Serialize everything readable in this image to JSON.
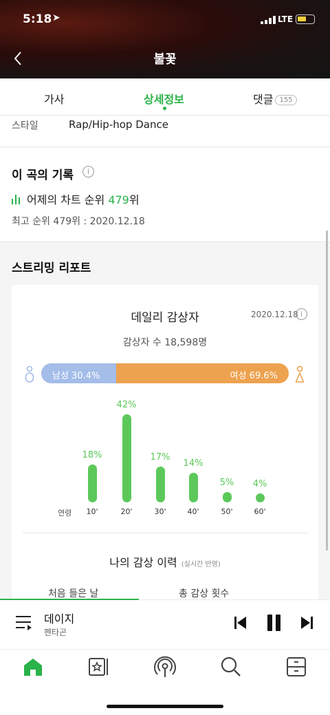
{
  "status": {
    "time": "5:18",
    "network": "LTE"
  },
  "header": {
    "title": "불꽃"
  },
  "tabs": [
    {
      "label": "가사"
    },
    {
      "label": "상세정보"
    },
    {
      "label": "댓글",
      "badge": "155"
    }
  ],
  "details": {
    "style_key": "스타일",
    "style_value": "Rap/Hip-hop Dance"
  },
  "record": {
    "title": "이 곡의 기록",
    "chart_prefix": "어제의 차트 순위 ",
    "chart_rank": "479",
    "chart_suffix": "위",
    "best": "최고 순위 479위 : 2020.12.18"
  },
  "streaming": {
    "title": "스트리밍 리포트",
    "daily_title": "데일리 감상자",
    "date": "2020.12.18",
    "listeners": "감상자 수 18,598명",
    "male_label": "남성 30.4%",
    "male_pct": 30.4,
    "female_label": "여성 69.6%",
    "age_axis_label": "연령",
    "ages": [
      {
        "label": "10'",
        "pct_text": "18%",
        "pct": 18
      },
      {
        "label": "20'",
        "pct_text": "42%",
        "pct": 42
      },
      {
        "label": "30'",
        "pct_text": "17%",
        "pct": 17
      },
      {
        "label": "40'",
        "pct_text": "14%",
        "pct": 14
      },
      {
        "label": "50'",
        "pct_text": "5%",
        "pct": 5
      },
      {
        "label": "60'",
        "pct_text": "4%",
        "pct": 4
      }
    ],
    "my_history": "나의 감상 이력",
    "my_history_note": "(실시간 반영)",
    "first_listen": "처음 들은 날",
    "total_count": "총 감상 횟수"
  },
  "player": {
    "song": "데이지",
    "artist": "펜타곤",
    "progress": 0.42
  },
  "nav": [
    "home-icon",
    "library-icon",
    "podcast-icon",
    "search-icon",
    "storage-icon"
  ],
  "colors": {
    "accent": "#2ab34a",
    "male": "#a4bde9",
    "female": "#eda24f",
    "bar": "#5cc85a"
  }
}
